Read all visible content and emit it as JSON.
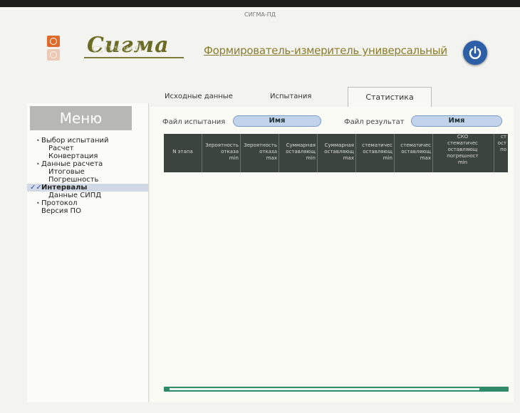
{
  "window": {
    "title": "СИГМА-ПД"
  },
  "header": {
    "brand": "Сигма",
    "brand_reflection": "Сигма",
    "subtitle": "Формирователь-измеритель универсальный"
  },
  "tabs": [
    {
      "label": "Исходные данные",
      "active": false
    },
    {
      "label": "Испытания",
      "active": false
    },
    {
      "label": "Статистика",
      "active": true
    }
  ],
  "sidebar": {
    "header": "Меню",
    "items": [
      {
        "label": "Выбор испытаний",
        "level": 0,
        "bullet": "•"
      },
      {
        "label": "Расчет",
        "level": 1
      },
      {
        "label": "Конвертация",
        "level": 1
      },
      {
        "label": "Данные расчета",
        "level": 0,
        "bullet": "•"
      },
      {
        "label": "Итоговые",
        "level": 1
      },
      {
        "label": "Погрешность",
        "level": 1
      },
      {
        "label": "Интервалы",
        "level": 0,
        "check": "✓✓",
        "selected": true
      },
      {
        "label": "Данные СИПД",
        "level": 1
      },
      {
        "label": "Протокол",
        "level": 0,
        "bullet": "•"
      },
      {
        "label": "Версия ПО",
        "level": 0
      }
    ]
  },
  "fields": {
    "test_file_label": "Файл испытания",
    "test_file_value": "Имя",
    "result_file_label": "Файл результат",
    "result_file_value": "Имя"
  },
  "table": {
    "columns": [
      "N этапа",
      "Зероятность\nотказа\nmin",
      "Зероятность\nотказа\nmax",
      "Суммарная\nоставляющ\nmin",
      "Суммарная\nоставляющ\nmax",
      "стематичес\nоставляющ\nmin",
      "стематичес\nоставляющ\nmax",
      "СКО\nстематичес\nоставляющ\nпогрешност\nmin",
      "ст\nост\nпо"
    ]
  },
  "progress": {
    "fraction": 0.93
  },
  "colors": {
    "accent": "#2e8a68",
    "table_header": "#3c443f",
    "power": "#2d5fa6",
    "brand": "#6b6b24"
  },
  "icons": {
    "power": "power-icon",
    "logo": "sigma-logo-icon"
  }
}
